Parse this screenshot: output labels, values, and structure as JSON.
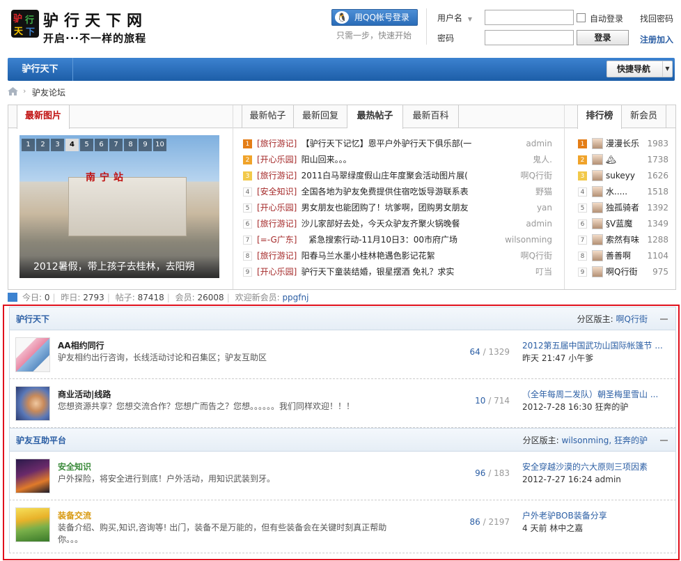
{
  "header": {
    "logo_title": "驴行天下网",
    "logo_slogan": "开启···不一样的旅程",
    "logo_badge": "驴行天下"
  },
  "login": {
    "qq_button": "用QQ帐号登录",
    "qq_sub": "只需一步，快速开始",
    "username_label": "用户名",
    "password_label": "密码",
    "auto_login": "自动登录",
    "find_password": "找回密码",
    "login_button": "登录",
    "register": "注册加入"
  },
  "nav": {
    "item": "驴行天下",
    "quick_nav": "快捷导航"
  },
  "breadcrumb": {
    "current": "驴友论坛"
  },
  "portal": {
    "pic_tab": "最新图片",
    "thread_tabs": [
      "最新帖子",
      "最新回复",
      "最热帖子",
      "最新百科"
    ],
    "rank_tabs": [
      "排行榜",
      "新会员"
    ],
    "slide_pages": [
      "1",
      "2",
      "3",
      "4",
      "5",
      "6",
      "7",
      "8",
      "9",
      "10"
    ],
    "slide_active": "4",
    "slide_sign": "南宁站",
    "slide_caption": "2012暑假，带上孩子去桂林，去阳朔",
    "threads": [
      {
        "n": "1",
        "cat": "[旅行游记]",
        "title": "【驴行天下记忆】恩平户外驴行天下俱乐部(一",
        "author": "admin"
      },
      {
        "n": "2",
        "cat": "[开心乐园]",
        "title": "阳山回来。。。",
        "author": "鬼人."
      },
      {
        "n": "3",
        "cat": "[旅行游记]",
        "title": "2011白马翠绿度假山庄年度聚会活动图片展(",
        "author": "啊Q行街"
      },
      {
        "n": "4",
        "cat": "[安全知识]",
        "title": "全国各地为驴友免费提供住宿吃饭导游联系表",
        "author": "野猫"
      },
      {
        "n": "5",
        "cat": "[开心乐园]",
        "title": "男女朋友也能团购了！坑爹啊，团购男女朋友",
        "author": "yan"
      },
      {
        "n": "6",
        "cat": "[旅行游记]",
        "title": "沙儿家部好去处，今天众驴友齐聚火锅晚餐",
        "author": "admin"
      },
      {
        "n": "7",
        "cat": "[=-G广东]",
        "title": "紧急搜索行动-11月10日3：00市府广场",
        "author": "wilsonming"
      },
      {
        "n": "8",
        "cat": "[旅行游记]",
        "title": "阳春马兰水墨小桂林艳遇色影记花絮",
        "author": "啊Q行街"
      },
      {
        "n": "9",
        "cat": "[开心乐园]",
        "title": "驴行天下童装结婚，银星摆酒 免礼？求实",
        "author": "叮当"
      }
    ],
    "ranks": [
      {
        "n": "1",
        "name": "漫漫长乐",
        "val": "1983"
      },
      {
        "n": "2",
        "name": "🏔",
        "val": "1738"
      },
      {
        "n": "3",
        "name": "sukeyy",
        "val": "1626"
      },
      {
        "n": "4",
        "name": "水.....",
        "val": "1518"
      },
      {
        "n": "5",
        "name": "独孤骑者",
        "val": "1392"
      },
      {
        "n": "6",
        "name": "§V蓝魔",
        "val": "1349"
      },
      {
        "n": "7",
        "name": "索然有味",
        "val": "1288"
      },
      {
        "n": "8",
        "name": "善善啊",
        "val": "1104"
      },
      {
        "n": "9",
        "name": "啊Q行街",
        "val": "975"
      }
    ]
  },
  "stats": {
    "today_label": "今日:",
    "today": "0",
    "yesterday_label": "昨日:",
    "yesterday": "2793",
    "posts_label": "帖子:",
    "posts": "87418",
    "members_label": "会员:",
    "members": "26008",
    "welcome_label": "欢迎新会员:",
    "welcome_user": "ppgfnj"
  },
  "sections": [
    {
      "title": "驴行天下",
      "mod_label": "分区版主:",
      "mods": "啊Q行街",
      "forums": [
        {
          "name": "AA相约同行",
          "desc": "驴友相约出行咨询，长线活动讨论和召集区；驴友互助区",
          "threads": "64",
          "posts": "1329",
          "last_title": "2012第五届中国武功山国际帐篷节 ...",
          "last_meta": "昨天 21:47 小午爹"
        },
        {
          "name": "商业活动|线路",
          "desc": "您想资源共享？您想交流合作？您想广而告之？您想。。。。。。我们同样欢迎！！！",
          "threads": "10",
          "posts": "714",
          "last_title": "（全年每周二发队）朝圣梅里雪山 ...",
          "last_meta": "2012-7-28 16:30 狂奔的驴"
        }
      ]
    },
    {
      "title": "驴友互助平台",
      "mod_label": "分区版主:",
      "mods": "wilsonming, 狂奔的驴",
      "forums": [
        {
          "name": "安全知识",
          "desc": "户外探险，将安全进行到底！户外活动，用知识武装到牙。",
          "threads": "96",
          "posts": "183",
          "last_title": "安全穿越沙漠的六大原则三项因素",
          "last_meta": "2012-7-27 16:24 admin"
        },
        {
          "name": "装备交流",
          "desc": "装备介绍、购买,知识,咨询等! 出门，装备不是万能的，但有些装备会在关键时刻真正帮助你。。。",
          "threads": "86",
          "posts": "2197",
          "last_title": "户外老驴BOB装备分享",
          "last_meta": "4 天前 林中之嘉"
        }
      ]
    }
  ]
}
